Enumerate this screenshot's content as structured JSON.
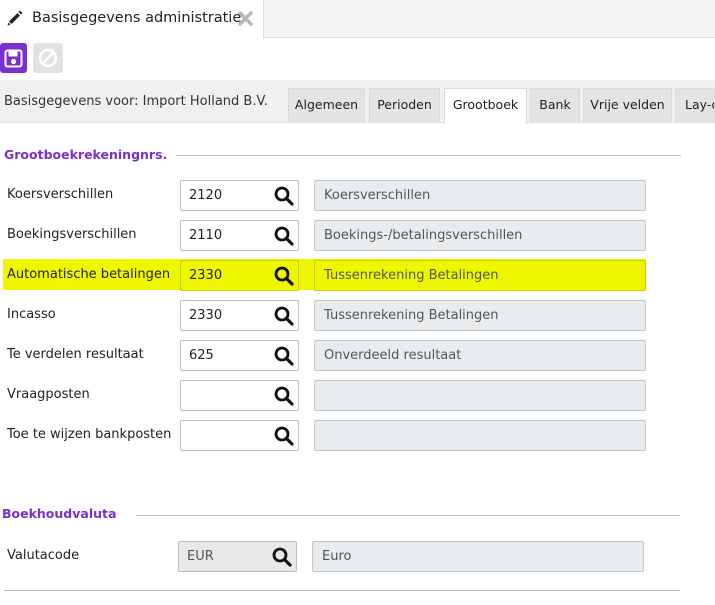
{
  "window": {
    "tab_title": "Basisgegevens administratie",
    "icons": {
      "edit": "pencil-icon",
      "close": "close-icon"
    }
  },
  "toolbar": {
    "save_icon": "save-icon",
    "cancel_icon": "cancel-icon",
    "accent": "#7b2fd0"
  },
  "header": {
    "label": "Basisgegevens voor: Import Holland B.V."
  },
  "tabs": [
    {
      "label": "Algemeen",
      "active": false
    },
    {
      "label": "Perioden",
      "active": false
    },
    {
      "label": "Grootboek",
      "active": true
    },
    {
      "label": "Bank",
      "active": false
    },
    {
      "label": "Vrije velden",
      "active": false
    },
    {
      "label": "Lay-out",
      "active": false
    }
  ],
  "ledger_section": {
    "title": "Grootboekrekeningnrs.",
    "highlight_color": "#eef700",
    "rows": [
      {
        "label": "Koersverschillen",
        "code": "2120",
        "description": "Koersverschillen",
        "highlighted": false
      },
      {
        "label": "Boekingsverschillen",
        "code": "2110",
        "description": "Boekings-/betalingsverschillen",
        "highlighted": false
      },
      {
        "label": "Automatische betalingen",
        "code": "2330",
        "description": "Tussenrekening Betalingen",
        "highlighted": true
      },
      {
        "label": "Incasso",
        "code": "2330",
        "description": "Tussenrekening Betalingen",
        "highlighted": false
      },
      {
        "label": "Te verdelen resultaat",
        "code": "625",
        "description": "Onverdeeld resultaat",
        "highlighted": false
      },
      {
        "label": "Vraagposten",
        "code": "",
        "description": "",
        "highlighted": false
      },
      {
        "label": "Toe te wijzen bankposten",
        "code": "",
        "description": "",
        "highlighted": false
      }
    ]
  },
  "currency_section": {
    "title": "Boekhoudvaluta",
    "row": {
      "label": "Valutacode",
      "code": "EUR",
      "description": "Euro"
    }
  }
}
